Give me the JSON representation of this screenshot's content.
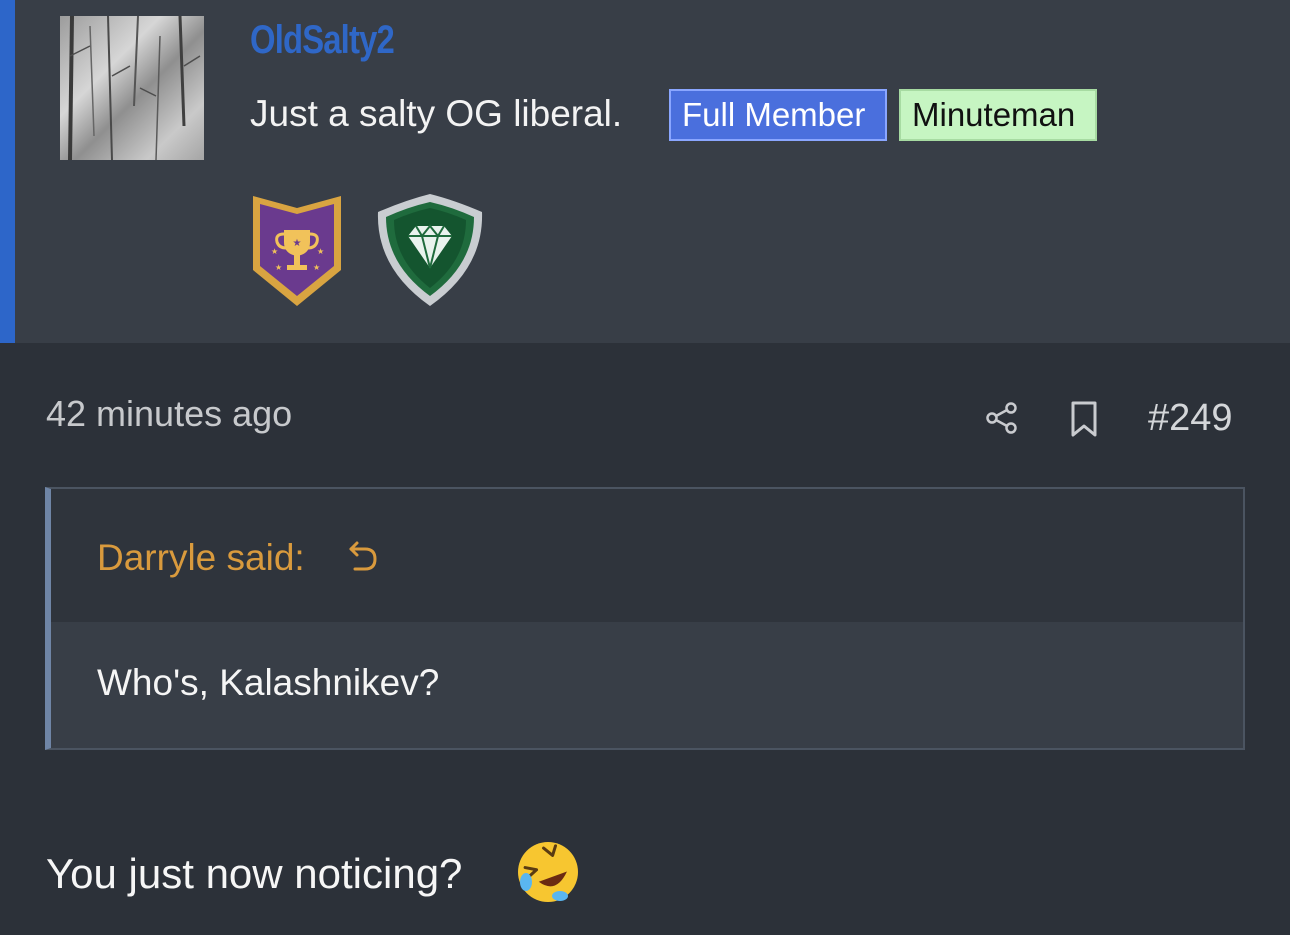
{
  "user": {
    "username": "OldSalty2",
    "title": "Just a salty OG liberal.",
    "banners": [
      "Full Member",
      "Minuteman"
    ],
    "trophies": [
      "trophy-shield-icon",
      "diamond-shield-icon"
    ]
  },
  "post": {
    "time": "42 minutes ago",
    "number": "#249",
    "quote": {
      "author": "Darryle said:",
      "text": "Who's, Kalashnikev?"
    },
    "message": "You just now noticing?",
    "emoji": "rolling-on-floor-laughing-emoji"
  },
  "colors": {
    "accent": "#2d66c9",
    "username": "#2f67c7",
    "full_member_badge": "#4a6fdd",
    "minuteman_badge": "#c6f5c2",
    "quote_author": "#d99a3d",
    "background": "#2c3139"
  }
}
